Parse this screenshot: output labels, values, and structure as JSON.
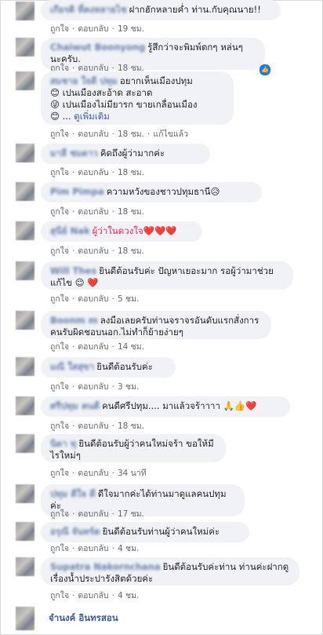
{
  "labels": {
    "like": "ถูกใจ",
    "reply": "ตอบกลับ",
    "dot": "·"
  },
  "comments": [
    {
      "name": "เกียรติ ที่คงหลายไช",
      "text": "ฝากฮักหลายค่ำ ท่าน.กับคุณนาย!!",
      "time": "19 ชม."
    },
    {
      "name": "Chaiwut Boonyong",
      "text": "รู้สึกว่าจะพิมพ์ตกๆ หล่นๆ นะครับ.",
      "time": "18 ชม."
    },
    {
      "name": "สมชาย ใจดี ปทุม",
      "text": "อยากเห็นเมืองปทุม",
      "lines": [
        "😊 เปนเมืองสะอ้าด สะอาด",
        "😜 เปนเมืองไม่มียารก ขายเกลื่อนเมือง",
        "😊 ...",
        "ดูเพิ่มเติม"
      ],
      "time": "18 ชม.",
      "extra": "แก้ไขแล้ว"
    },
    {
      "name": "มาลี ชมดาว",
      "text": "คิดถึงผู้ว่ามากค่ะ",
      "time": "18 ชม."
    },
    {
      "name": "Pim Pimpa",
      "text": "ความหวังของชาวปทุมธานี😥",
      "time": "18 ชม."
    },
    {
      "name": "สุนีย์ Nak",
      "text": "ผู้ว่าในดวงใจ❤️❤️❤️",
      "time": "18 ชม."
    },
    {
      "name": "Will Thes",
      "text": "ยินดีต้อนรับค่ะ ปัญหาเยอะมาก รอผู้ว่ามาช่วยแก้ไข 😌 ❤️",
      "time": "5 ชม."
    },
    {
      "name": "Boonm m",
      "text": "ลงมือเลยครับท่านจราจรอันดับแรกสั่งการคนรับผิดชอบนอก.ไม่ทำก็ย้ายง่ายๆ",
      "time": "14 ชม."
    },
    {
      "name": "มณี ใสสุขา",
      "text": "ยินดีต้อนรับค่ะ",
      "time": "3 ชม."
    },
    {
      "name": "ศรีปทุม คนดี",
      "text": "คนดีศรีปทุม.... มาแล้วจร้าาาา 🙏👍❤️",
      "time": "18 ชม."
    },
    {
      "name": "นิดา ทุ",
      "text": "ยินดีต้อนรับผู้ว่าคนใหม่จร้า ขอให้มีไรใหม่ๆ",
      "time": "34 นาที"
    },
    {
      "name": "ปทุม ดีใจ ดี",
      "text": "ดีใจมากค่ะได้ท่านมาดูแลคนปทุมค่ะ",
      "time": "17 ชม."
    },
    {
      "name": "อรุณี จันทร์ด",
      "text": "ยินดีต้อนรับท่านผู้ว่าคนใหม่ค่ะ",
      "time": "4 ชม."
    },
    {
      "name": "Supatra Nakornchana",
      "text": "ยินดีต้อนรับค่ะท่าน ท่านค่ะฝากดูเรื่องน้ำประปารังสิตด้วยค่ะ",
      "time": "4 ชม."
    },
    {
      "name": "จำนงค์ อินทรสอน",
      "text": "",
      "time": ""
    }
  ]
}
